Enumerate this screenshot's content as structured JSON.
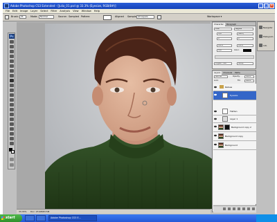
{
  "window": {
    "title": "Adobe Photoshop CS3 Extended - [Julia_01.psd @ 33.3% (Eyesize, RGB/8#)]"
  },
  "menu": [
    "File",
    "Edit",
    "Image",
    "Layer",
    "Select",
    "Filter",
    "Analysis",
    "View",
    "Window",
    "Help"
  ],
  "options": {
    "brush_label": "Brush:",
    "brush_size": "21",
    "mode_label": "Mode:",
    "mode_value": "Normal",
    "source_label": "Source:",
    "sampled": "Sampled",
    "pattern": "Pattern:",
    "aligned": "Aligned",
    "sample_label": "Sample:",
    "sample_value": "All Layers",
    "workspace": "Workspace ▾"
  },
  "status": {
    "zoom": "33.33%",
    "doc": "Doc: 23.9M/83.5M"
  },
  "character_panel": {
    "tabs": [
      "Character",
      "Paragraph"
    ],
    "font": "Arial",
    "style": "Regular",
    "size": "8 pt",
    "leading": "(Auto)",
    "kerning": "0",
    "tracking": "0",
    "vscale": "100%",
    "hscale": "100%",
    "baseline": "0 pt",
    "color_label": "Color:",
    "language": "English: USA",
    "aa": "Sharp"
  },
  "layers_panel": {
    "tabs": [
      "Layers",
      "Channels",
      "Paths",
      "Just Presets"
    ],
    "blend_mode": "Normal",
    "opacity_label": "Opacity:",
    "opacity": "100%",
    "lock_label": "Lock:",
    "fill_label": "Fill:",
    "fill": "100%",
    "layers": [
      {
        "name": "Retusa",
        "type": "group"
      },
      {
        "name": "Eyesize",
        "type": "layer",
        "selected": true
      },
      {
        "name": "Flatten",
        "type": "layer"
      },
      {
        "name": "Layer 1",
        "type": "layer"
      },
      {
        "name": "Background copy 2",
        "type": "layer"
      },
      {
        "name": "Background copy",
        "type": "layer"
      },
      {
        "name": "Background",
        "type": "layer"
      }
    ]
  },
  "navigator": {
    "items": [
      {
        "label": "Navigator",
        "icon": "navigator-icon"
      },
      {
        "label": "Histogram",
        "icon": "histogram-icon"
      },
      {
        "label": "Info",
        "icon": "info-icon"
      }
    ]
  },
  "taskbar": {
    "start": "start",
    "tasks": [
      "",
      "",
      "Adobe Photoshop CS3 E..."
    ],
    "clock": ""
  },
  "colors": {
    "title_blue": "#1542b8",
    "selection": "#3466c8",
    "sweater": "#2d4a1e",
    "skin": "#d8ad93",
    "hair": "#4a2418",
    "backdrop": "#b9bcc0"
  }
}
